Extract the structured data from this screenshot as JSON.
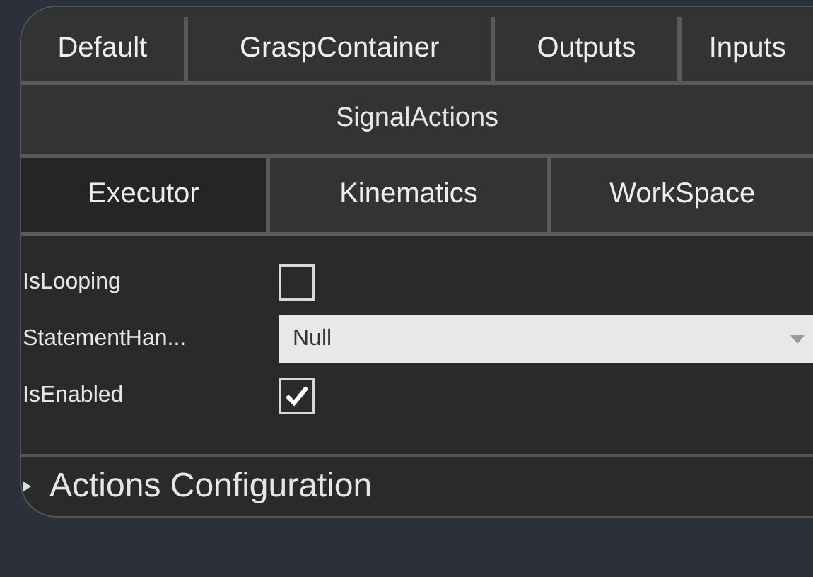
{
  "tabs": [
    {
      "label": "Default",
      "selected": false
    },
    {
      "label": "GraspContainer",
      "selected": false
    },
    {
      "label": "Outputs",
      "selected": false
    },
    {
      "label": "Inputs",
      "selected": false
    }
  ],
  "group_header": "SignalActions",
  "sub_tabs": [
    {
      "label": "Executor",
      "selected": true
    },
    {
      "label": "Kinematics",
      "selected": false
    },
    {
      "label": "WorkSpace",
      "selected": false
    }
  ],
  "properties": [
    {
      "kind": "checkbox",
      "label": "IsLooping",
      "checked": false
    },
    {
      "kind": "dropdown",
      "label": "StatementHan...",
      "value": "Null"
    },
    {
      "kind": "checkbox",
      "label": "IsEnabled",
      "checked": true
    }
  ],
  "section": {
    "title": "Actions Configuration",
    "expanded": false
  }
}
